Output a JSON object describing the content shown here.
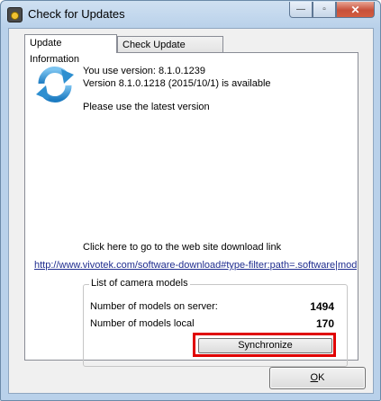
{
  "window": {
    "title": "Check for Updates",
    "app_icon": "camera-app-icon",
    "controls": {
      "minimize": "—",
      "maximize": "▫",
      "close": "✕"
    }
  },
  "tabs": [
    {
      "label": "Update Information",
      "active": true
    },
    {
      "label": "Check Update Settings",
      "active": false
    }
  ],
  "update_info": {
    "icon": "refresh-icon",
    "current_version": "You use version: 8.1.0.1239",
    "available_version": "Version 8.1.0.1218 (2015/10/1) is available",
    "advice": "Please use the latest version",
    "goto_text": "Click here to go to the web site download link",
    "download_link": "http://www.vivotek.com/software-download#type-filter:path=.software|mode"
  },
  "camera_models": {
    "legend": "List of camera models",
    "server_label": "Number of models on server:",
    "server_count": "1494",
    "local_label": "Number of models local",
    "local_count": "170",
    "sync_label": "Synchronize"
  },
  "footer": {
    "ok_accel": "O",
    "ok_rest": "K"
  },
  "colors": {
    "highlight": "#e00000",
    "link": "#1f2d8f",
    "icon_blue": "#2e8fd0"
  }
}
